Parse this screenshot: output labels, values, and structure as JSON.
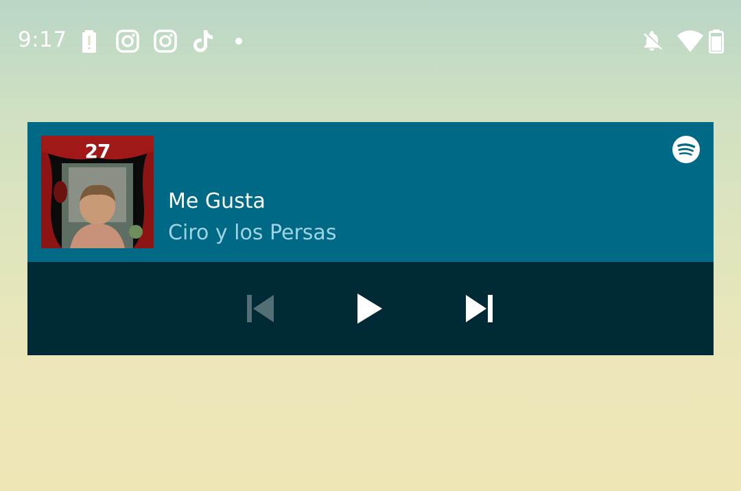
{
  "status_bar": {
    "time": "9:17",
    "left_icons": [
      "battery-alert-icon",
      "instagram-icon",
      "instagram-icon",
      "tiktok-icon",
      "notification-dot-icon"
    ],
    "right_icons": [
      "notifications-off-icon",
      "wifi-icon",
      "battery-icon"
    ]
  },
  "media_widget": {
    "album_art": {
      "label": "27"
    },
    "track_title": "Me Gusta",
    "artist": "Ciro y los Persas",
    "app_icon": "spotify-icon",
    "controls": {
      "previous": {
        "icon": "skip-previous-icon",
        "enabled": false
      },
      "play": {
        "icon": "play-icon"
      },
      "next": {
        "icon": "skip-next-icon",
        "enabled": true
      }
    }
  },
  "colors": {
    "widget_top": "#006a86",
    "widget_controls": "#002a36",
    "artist_text": "#9fd3e2"
  }
}
